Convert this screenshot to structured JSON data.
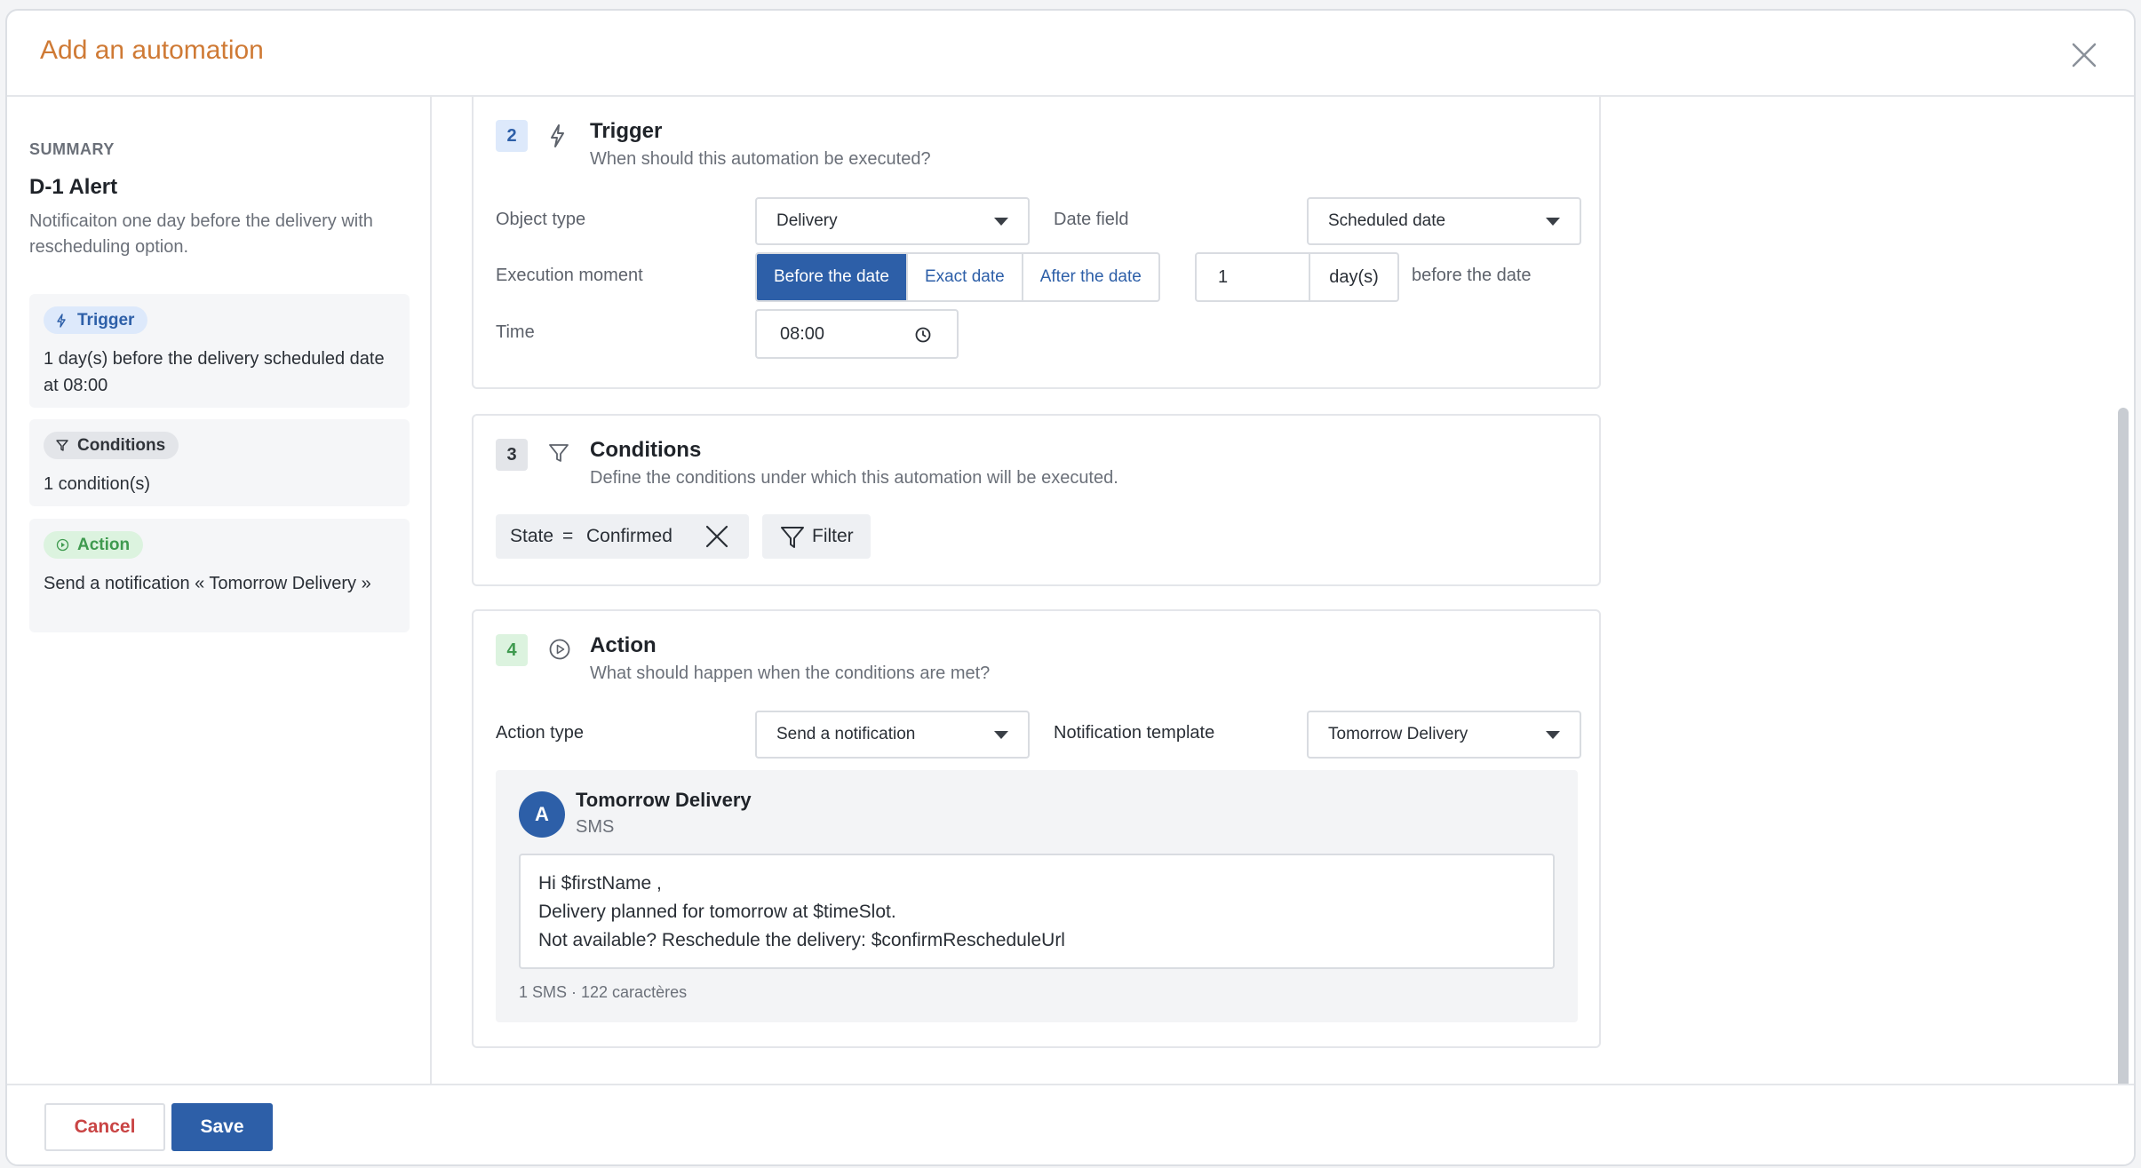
{
  "modal": {
    "title": "Add an automation",
    "close_icon": "close-icon"
  },
  "summary": {
    "label": "SUMMARY",
    "name": "D-1 Alert",
    "description": "Notificaiton one day before the delivery with rescheduling option.",
    "cards": [
      {
        "chip": "Trigger",
        "icon": "lightning-icon",
        "text": "1 day(s) before the delivery scheduled date at 08:00"
      },
      {
        "chip": "Conditions",
        "icon": "filter-icon",
        "text": "1 condition(s)"
      },
      {
        "chip": "Action",
        "icon": "play-icon",
        "text": "Send a notification « Tomorrow Delivery »"
      }
    ]
  },
  "trigger": {
    "step": "2",
    "title": "Trigger",
    "subtitle": "When should this automation be executed?",
    "object_type_label": "Object type",
    "object_type_value": "Delivery",
    "date_field_label": "Date field",
    "date_field_value": "Scheduled date",
    "execution_moment_label": "Execution moment",
    "moments": [
      "Before the date",
      "Exact date",
      "After the date"
    ],
    "selected_moment": "Before the date",
    "offset_value": "1",
    "offset_unit": "day(s)",
    "offset_suffix": "before the date",
    "time_label": "Time",
    "time_value": "08:00"
  },
  "conditions": {
    "step": "3",
    "title": "Conditions",
    "subtitle": "Define the conditions under which this automation will be executed.",
    "filter_field": "State",
    "filter_operator": "=",
    "filter_value": "Confirmed",
    "filter_button": "Filter"
  },
  "action": {
    "step": "4",
    "title": "Action",
    "subtitle": "What should happen when the conditions are met?",
    "action_type_label": "Action type",
    "action_type_value": "Send a notification",
    "template_label": "Notification template",
    "template_value": "Tomorrow Delivery",
    "notification": {
      "avatar": "A",
      "title": "Tomorrow Delivery",
      "channel": "SMS",
      "lines": [
        "Hi $firstName ,",
        "Delivery planned for tomorrow at $timeSlot.",
        "Not available? Reschedule the delivery: $confirmRescheduleUrl"
      ],
      "count": "1 SMS · 122 caractères"
    }
  },
  "footer": {
    "cancel": "Cancel",
    "save": "Save"
  },
  "colors": {
    "accent": "#2d5fa8",
    "title": "#cf7a35",
    "danger": "#c94444",
    "success": "#3f9a4f"
  }
}
